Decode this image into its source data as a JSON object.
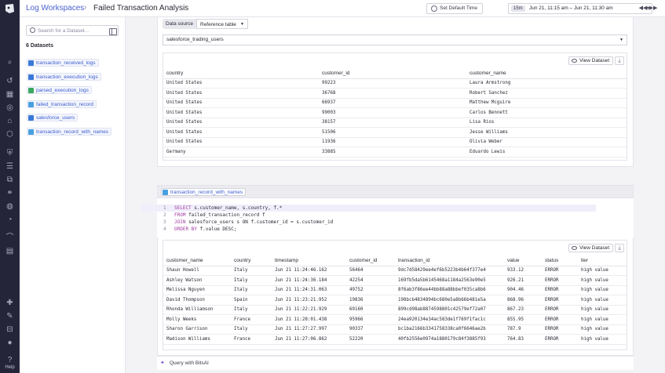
{
  "nav": {
    "icons": [
      "logo-icon",
      "search-icon",
      "history-icon",
      "dashboards-icon",
      "monitors-icon",
      "apm-icon",
      "infrastructure-icon",
      "security-icon",
      "rum-icon",
      "integrations-icon",
      "notebooks-icon",
      "logs-icon",
      "metrics-icon",
      "ci-icon",
      "incidents-icon",
      "settings-icon",
      "alerts-icon",
      "users-icon",
      "team-icon",
      "avatar-icon",
      "help-icon"
    ],
    "help_label": "Help"
  },
  "header": {
    "breadcrumb_root": "Log Workspaces",
    "separator": "›",
    "title": "Failed Transaction Analysis",
    "default_time_label": "Set Default Time",
    "time_badge": "15m",
    "time_range": "Jun 21, 11:15 am – Jun 21, 11:30 am",
    "caret": "▾",
    "prev": "◀◀",
    "next": "▶▶"
  },
  "sidebar": {
    "search_placeholder": "Search for a Dataset...",
    "datasets_count": "6 Datasets",
    "datasets": [
      {
        "label": "transaction_received_logs",
        "color": "#3a78d8"
      },
      {
        "label": "transaction_execution_logs",
        "color": "#3a78d8"
      },
      {
        "label": "parsed_execution_logs",
        "color": "#3aa860"
      },
      {
        "label": "failed_transaction_record",
        "color": "#48a0e0"
      },
      {
        "label": "salesforce_users",
        "color": "#3a78d8"
      },
      {
        "label": "transaction_record_with_names",
        "color": "#48a0e0"
      }
    ]
  },
  "source_cell": {
    "tab_data_source": "Data source",
    "tab_reference": "Reference table",
    "selected_table": "salesforce_trading_users",
    "view_dataset": "View Dataset",
    "download": "⤓",
    "columns": [
      "country",
      "customer_id",
      "customer_name"
    ],
    "rows": [
      [
        "United States",
        "99223",
        "Laura Armstrong"
      ],
      [
        "United States",
        "36768",
        "Robert Sanchez"
      ],
      [
        "United States",
        "66937",
        "Matthew Mcguire"
      ],
      [
        "United States",
        "99003",
        "Carlos Bennett"
      ],
      [
        "United States",
        "38157",
        "Lisa Rios"
      ],
      [
        "United States",
        "51506",
        "Jesse Williams"
      ],
      [
        "United States",
        "11936",
        "Olivia Weber"
      ],
      [
        "Germany",
        "33885",
        "Eduardo Lewis"
      ]
    ]
  },
  "query_cell": {
    "dataset_name": "transaction_record_with_names",
    "code": [
      {
        "n": "1",
        "kw": "SELECT",
        "rest": " s.customer_name, s.country, f.*"
      },
      {
        "n": "2",
        "kw": "FROM",
        "rest": " failed_transaction_record f"
      },
      {
        "n": "3",
        "kw": "JOIN",
        "rest": " salesforce_users s ON f.customer_id = s.customer_id"
      },
      {
        "n": "4",
        "kw": "ORDER BY",
        "rest": " f.value DESC;"
      }
    ],
    "view_dataset": "View Dataset",
    "download": "⤓",
    "columns": [
      "customer_name",
      "country",
      "timestamp",
      "customer_id",
      "transaction_id",
      "value",
      "status",
      "tier"
    ],
    "rows": [
      [
        "Shaun Howell",
        "Italy",
        "Jun 21 11:24:46.162",
        "56464",
        "9dc7d58429ee4ef6b5223b4b64f377e4",
        "933.12",
        "ERROR",
        "high value"
      ],
      [
        "Ashley Watson",
        "Italy",
        "Jun 21 11:24:36.184",
        "42254",
        "169fb5da5b6145468a1184a2563e90e5",
        "926.21",
        "ERROR",
        "high value"
      ],
      [
        "Melissa Nguyen",
        "Italy",
        "Jun 21 11:24:31.063",
        "49752",
        "8f6ab3f86ee44bb88a88bbef035ca8b6",
        "904.46",
        "ERROR",
        "high value"
      ],
      [
        "David Thompson",
        "Spain",
        "Jun 21 11:23:21.952",
        "19836",
        "198bcb4834894bc680e5a8b66b481e5a",
        "868.96",
        "ERROR",
        "high value"
      ],
      [
        "Rhonda Williamson",
        "Italy",
        "Jun 21 11:22:21.929",
        "69160",
        "899cd98ab8874598801c42579ef72a07",
        "867.23",
        "ERROR",
        "high value"
      ],
      [
        "Molly Weeks",
        "France",
        "Jun 21 11:28:01.438",
        "95966",
        "24ea920134e34ac583de1f769f1fac1c",
        "855.95",
        "ERROR",
        "high value"
      ],
      [
        "Sharon Garrison",
        "Italy",
        "Jun 21 11:27:27.997",
        "90337",
        "bc1ba2166b3341758338ca0f6646ae2b",
        "787.9",
        "ERROR",
        "high value"
      ],
      [
        "Madison Williams",
        "France",
        "Jun 21 11:27:06.862",
        "52220",
        "40fb2556e0974a1880179c84f3885f93",
        "764.83",
        "ERROR",
        "high value"
      ]
    ]
  },
  "bitsai": {
    "label": "Query with BitsAI",
    "icon": "✦"
  }
}
